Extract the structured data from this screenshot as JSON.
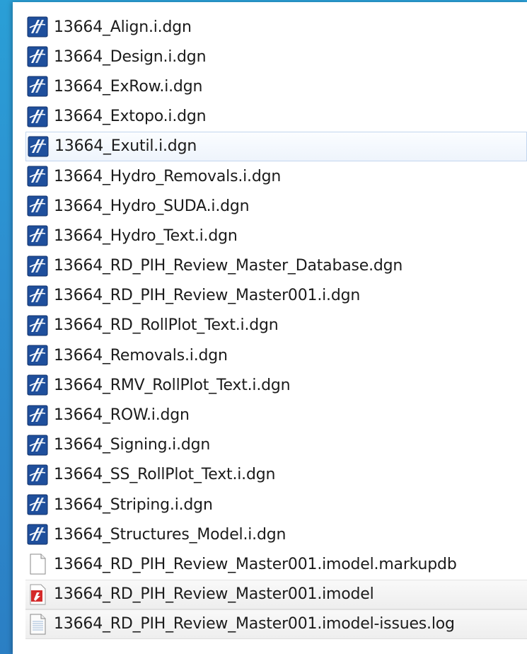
{
  "files": [
    {
      "name": "13664_Align.i.dgn",
      "icon": "microstation-dgn-icon",
      "state": "normal"
    },
    {
      "name": "13664_Design.i.dgn",
      "icon": "microstation-dgn-icon",
      "state": "normal"
    },
    {
      "name": "13664_ExRow.i.dgn",
      "icon": "microstation-dgn-icon",
      "state": "normal"
    },
    {
      "name": "13664_Extopo.i.dgn",
      "icon": "microstation-dgn-icon",
      "state": "normal"
    },
    {
      "name": "13664_Exutil.i.dgn",
      "icon": "microstation-dgn-icon",
      "state": "selected"
    },
    {
      "name": "13664_Hydro_Removals.i.dgn",
      "icon": "microstation-dgn-icon",
      "state": "normal"
    },
    {
      "name": "13664_Hydro_SUDA.i.dgn",
      "icon": "microstation-dgn-icon",
      "state": "normal"
    },
    {
      "name": "13664_Hydro_Text.i.dgn",
      "icon": "microstation-dgn-icon",
      "state": "normal"
    },
    {
      "name": "13664_RD_PIH_Review_Master_Database.dgn",
      "icon": "microstation-dgn-icon",
      "state": "normal"
    },
    {
      "name": "13664_RD_PIH_Review_Master001.i.dgn",
      "icon": "microstation-dgn-icon",
      "state": "normal"
    },
    {
      "name": "13664_RD_RollPlot_Text.i.dgn",
      "icon": "microstation-dgn-icon",
      "state": "normal"
    },
    {
      "name": "13664_Removals.i.dgn",
      "icon": "microstation-dgn-icon",
      "state": "normal"
    },
    {
      "name": "13664_RMV_RollPlot_Text.i.dgn",
      "icon": "microstation-dgn-icon",
      "state": "normal"
    },
    {
      "name": "13664_ROW.i.dgn",
      "icon": "microstation-dgn-icon",
      "state": "normal"
    },
    {
      "name": "13664_Signing.i.dgn",
      "icon": "microstation-dgn-icon",
      "state": "normal"
    },
    {
      "name": "13664_SS_RollPlot_Text.i.dgn",
      "icon": "microstation-dgn-icon",
      "state": "normal"
    },
    {
      "name": "13664_Striping.i.dgn",
      "icon": "microstation-dgn-icon",
      "state": "normal"
    },
    {
      "name": "13664_Structures_Model.i.dgn",
      "icon": "microstation-dgn-icon",
      "state": "normal"
    },
    {
      "name": "13664_RD_PIH_Review_Master001.imodel.markupdb",
      "icon": "blank-file-icon",
      "state": "normal"
    },
    {
      "name": "13664_RD_PIH_Review_Master001.imodel",
      "icon": "imodel-file-icon",
      "state": "alt"
    },
    {
      "name": "13664_RD_PIH_Review_Master001.imodel-issues.log",
      "icon": "text-log-file-icon",
      "state": "alt"
    }
  ],
  "colors": {
    "dgn_icon_bg": "#1f4f9c",
    "imodel_icon_red": "#d42a2a",
    "selected_border": "#c3d6ee",
    "background_blue": "#2b8fd0"
  }
}
